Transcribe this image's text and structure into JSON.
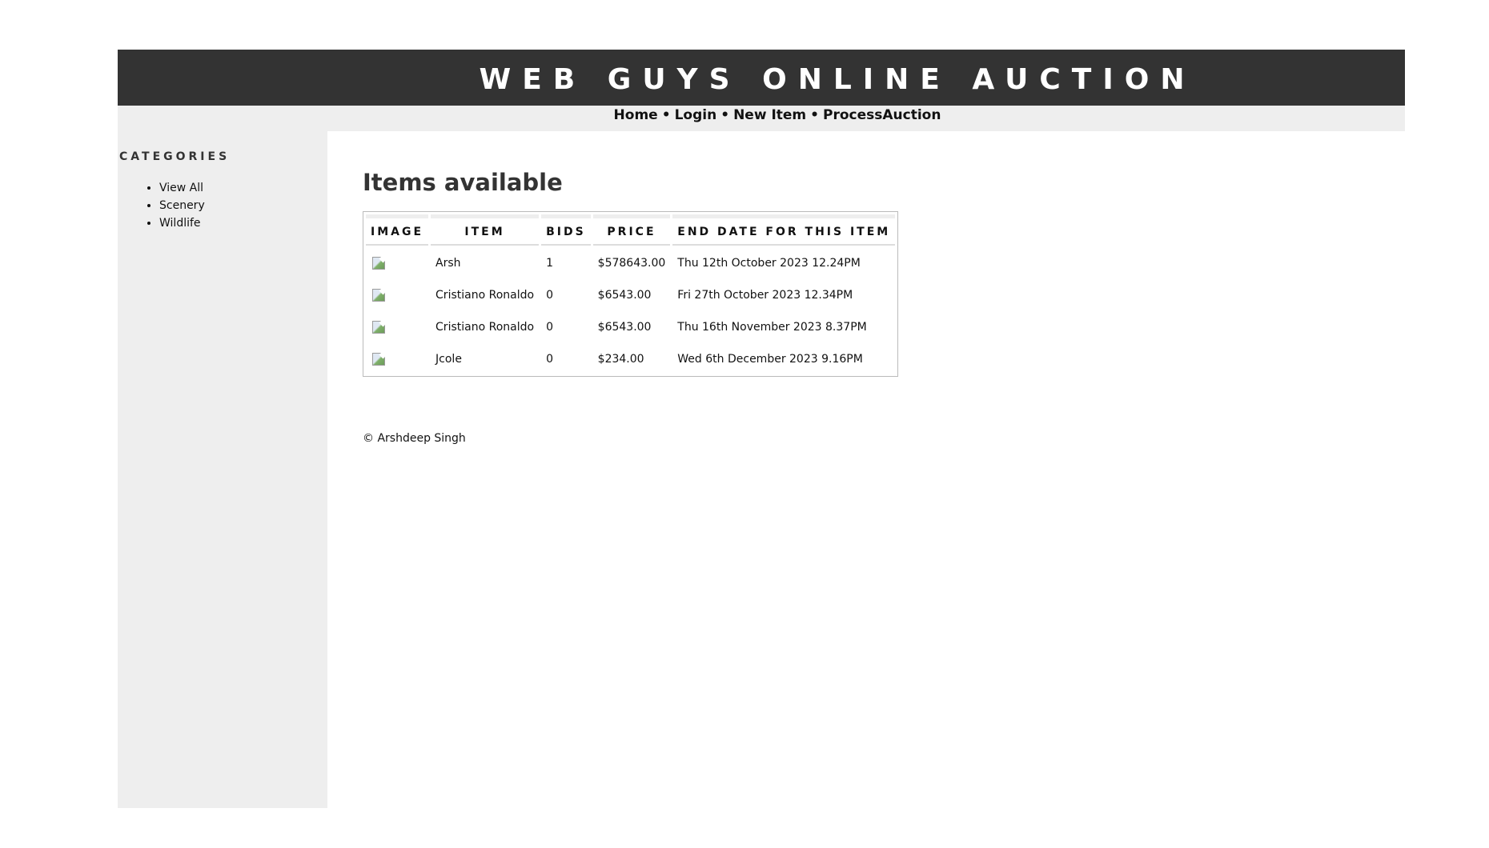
{
  "header": {
    "title": "WEB GUYS ONLINE AUCTION"
  },
  "nav": {
    "items": [
      {
        "label": "Home"
      },
      {
        "label": "Login"
      },
      {
        "label": "New Item"
      },
      {
        "label": "ProcessAuction"
      }
    ],
    "separator": "•"
  },
  "sidebar": {
    "heading": "CATEGORIES",
    "items": [
      {
        "label": "View All"
      },
      {
        "label": "Scenery"
      },
      {
        "label": "Wildlife"
      }
    ]
  },
  "main": {
    "heading": "Items available",
    "table": {
      "columns": [
        "IMAGE",
        "ITEM",
        "BIDS",
        "PRICE",
        "END DATE FOR THIS ITEM"
      ],
      "rows": [
        {
          "item": "Arsh",
          "bids": "1",
          "price": "$578643.00",
          "end_date": "Thu 12th October 2023 12.24PM"
        },
        {
          "item": "Cristiano Ronaldo",
          "bids": "0",
          "price": "$6543.00",
          "end_date": "Fri 27th October 2023 12.34PM"
        },
        {
          "item": "Cristiano Ronaldo",
          "bids": "0",
          "price": "$6543.00",
          "end_date": "Thu 16th November 2023 8.37PM"
        },
        {
          "item": "Jcole",
          "bids": "0",
          "price": "$234.00",
          "end_date": "Wed 6th December 2023 9.16PM"
        }
      ]
    },
    "footer": "© Arshdeep Singh"
  },
  "icons": {
    "row_image": "broken-image-icon"
  },
  "colors": {
    "header_bg": "#333333",
    "sidebar_bg": "#eeeeee"
  }
}
